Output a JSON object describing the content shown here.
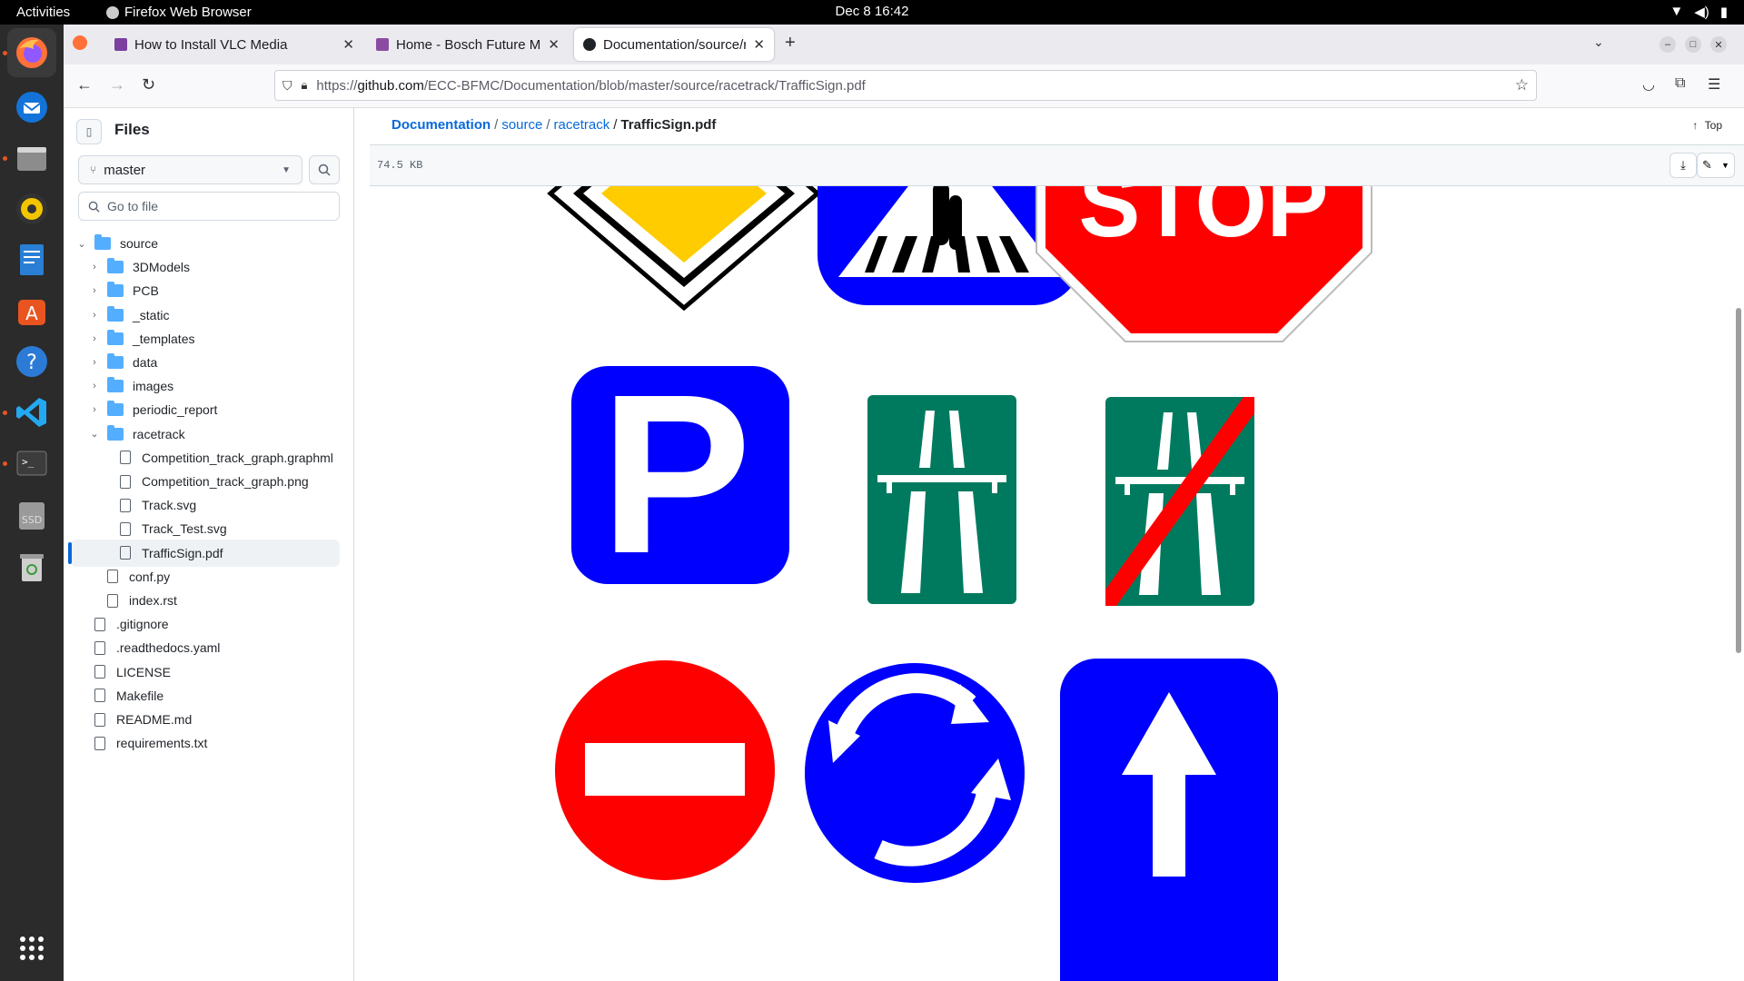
{
  "system": {
    "activities": "Activities",
    "app_name": "Firefox Web Browser",
    "clock": "Dec 8  16:42"
  },
  "tabs": [
    {
      "title": "How to Install VLC Media",
      "active": false
    },
    {
      "title": "Home - Bosch Future Mo",
      "active": false
    },
    {
      "title": "Documentation/source/r",
      "active": true
    }
  ],
  "url": {
    "prefix": "https://",
    "host": "github.com",
    "path": "/ECC-BFMC/Documentation/blob/master/source/racetrack/TrafficSign.pdf"
  },
  "sidebar": {
    "title": "Files",
    "branch": "master",
    "goto_placeholder": "Go to file",
    "tree": [
      {
        "label": "source",
        "type": "folder",
        "depth": 0,
        "expanded": true
      },
      {
        "label": "3DModels",
        "type": "folder",
        "depth": 1,
        "expanded": false
      },
      {
        "label": "PCB",
        "type": "folder",
        "depth": 1,
        "expanded": false
      },
      {
        "label": "_static",
        "type": "folder",
        "depth": 1,
        "expanded": false
      },
      {
        "label": "_templates",
        "type": "folder",
        "depth": 1,
        "expanded": false
      },
      {
        "label": "data",
        "type": "folder",
        "depth": 1,
        "expanded": false
      },
      {
        "label": "images",
        "type": "folder",
        "depth": 1,
        "expanded": false
      },
      {
        "label": "periodic_report",
        "type": "folder",
        "depth": 1,
        "expanded": false
      },
      {
        "label": "racetrack",
        "type": "folder",
        "depth": 1,
        "expanded": true
      },
      {
        "label": "Competition_track_graph.graphml",
        "type": "file",
        "depth": 2
      },
      {
        "label": "Competition_track_graph.png",
        "type": "file",
        "depth": 2
      },
      {
        "label": "Track.svg",
        "type": "file",
        "depth": 2
      },
      {
        "label": "Track_Test.svg",
        "type": "file",
        "depth": 2
      },
      {
        "label": "TrafficSign.pdf",
        "type": "file",
        "depth": 2,
        "selected": true
      },
      {
        "label": "conf.py",
        "type": "file",
        "depth": 1
      },
      {
        "label": "index.rst",
        "type": "file",
        "depth": 1
      },
      {
        "label": ".gitignore",
        "type": "file",
        "depth": 0
      },
      {
        "label": ".readthedocs.yaml",
        "type": "file",
        "depth": 0
      },
      {
        "label": "LICENSE",
        "type": "file",
        "depth": 0
      },
      {
        "label": "Makefile",
        "type": "file",
        "depth": 0
      },
      {
        "label": "README.md",
        "type": "file",
        "depth": 0
      },
      {
        "label": "requirements.txt",
        "type": "file",
        "depth": 0
      }
    ]
  },
  "breadcrumb": {
    "repo": "Documentation",
    "dir1": "source",
    "dir2": "racetrack",
    "file": "TrafficSign.pdf",
    "top_label": "Top"
  },
  "file": {
    "size": "74.5 KB"
  },
  "signs": {
    "stop_text": "STOP",
    "parking_text": "P"
  },
  "colors": {
    "sign_blue": "#0000ff",
    "sign_red": "#ff0000",
    "sign_green": "#007a5e",
    "sign_yellow": "#ffcc00",
    "link_blue": "#0969da"
  }
}
